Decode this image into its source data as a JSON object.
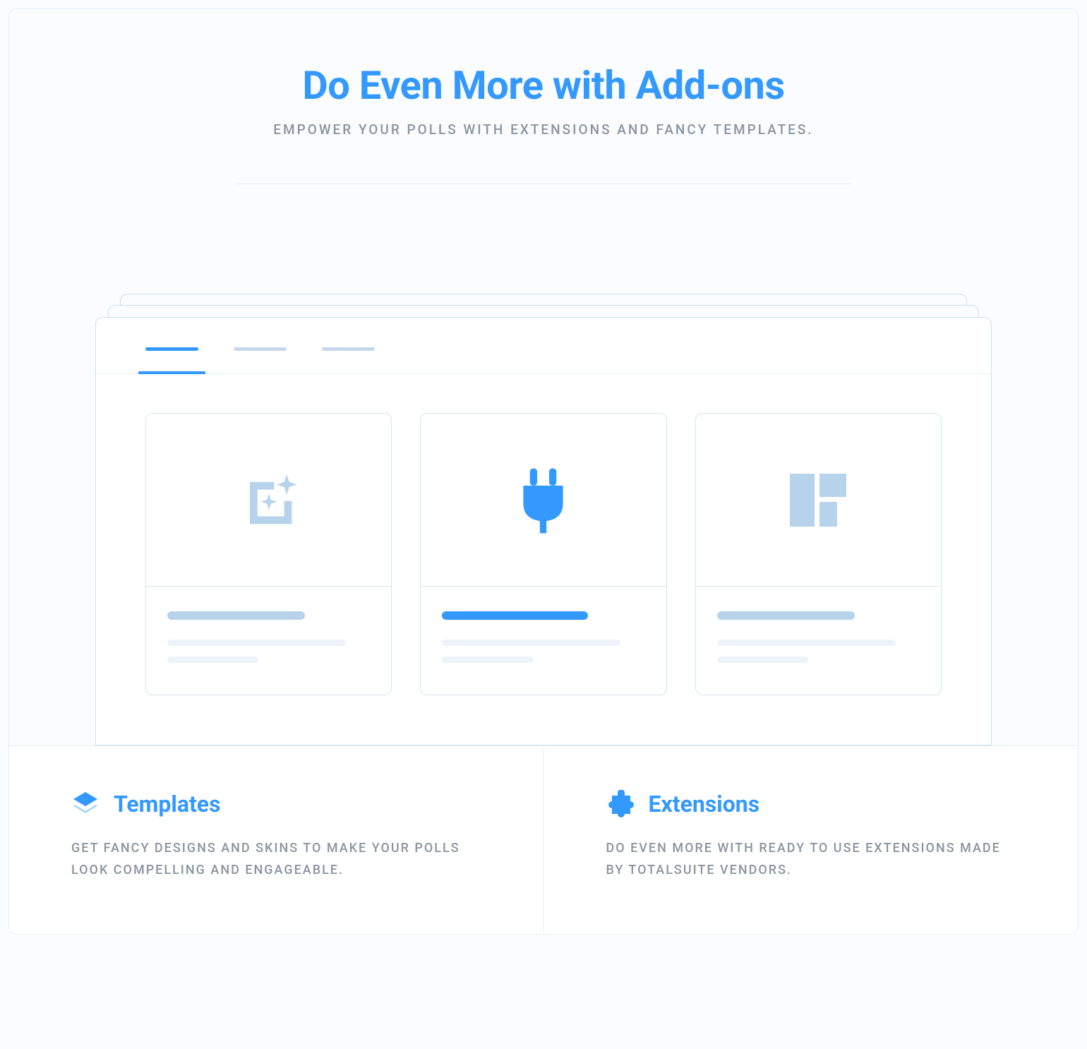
{
  "header": {
    "title": "Do Even More with Add-ons",
    "subtitle": "Empower your polls with extensions and fancy templates."
  },
  "colors": {
    "accent": "#3399ff",
    "light_blue": "#b7d3ec",
    "pale_blue": "#c5d8ea"
  },
  "info_sections": [
    {
      "icon": "layers-icon",
      "title": "Templates",
      "description": "Get fancy designs and skins to make your polls look compelling and engageable."
    },
    {
      "icon": "puzzle-icon",
      "title": "Extensions",
      "description": "Do even more with ready to use extensions made by TotalSuite vendors."
    }
  ]
}
